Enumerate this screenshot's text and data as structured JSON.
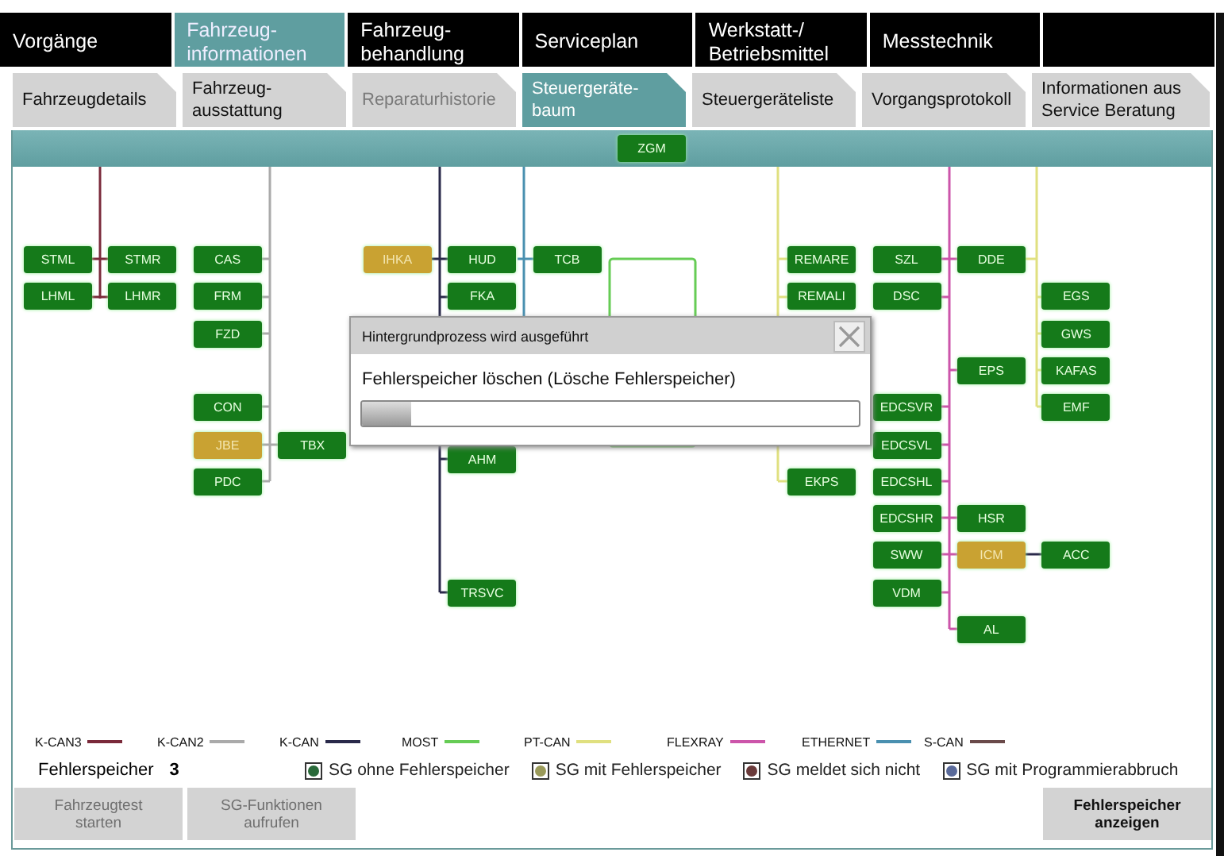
{
  "main_tabs": [
    {
      "label": "Vorgänge",
      "selected": false
    },
    {
      "label": "Fahrzeug-\ninformationen",
      "selected": true
    },
    {
      "label": "Fahrzeug-\nbehandlung",
      "selected": false
    },
    {
      "label": "Serviceplan",
      "selected": false
    },
    {
      "label": "Werkstatt-/\nBetriebsmittel",
      "selected": false
    },
    {
      "label": "Messtechnik",
      "selected": false
    }
  ],
  "sub_tabs": [
    {
      "label": "Fahrzeugdetails",
      "selected": false,
      "disabled": false
    },
    {
      "label": "Fahrzeug-\nausstattung",
      "selected": false,
      "disabled": false
    },
    {
      "label": "Reparaturhistorie",
      "selected": false,
      "disabled": true
    },
    {
      "label": "Steuergeräte-\nbaum",
      "selected": true,
      "disabled": false
    },
    {
      "label": "Steuergeräteliste",
      "selected": false,
      "disabled": false
    },
    {
      "label": "Vorgangsprotokoll",
      "selected": false,
      "disabled": false
    },
    {
      "label": "Informationen aus\nService Beratung",
      "selected": false,
      "disabled": false
    }
  ],
  "diagram": {
    "gateway": {
      "label": "ZGM",
      "fault": false
    },
    "nodes": [
      {
        "label": "STML",
        "fault": false
      },
      {
        "label": "STMR",
        "fault": false
      },
      {
        "label": "CAS",
        "fault": false
      },
      {
        "label": "IHKA",
        "fault": true
      },
      {
        "label": "HUD",
        "fault": false
      },
      {
        "label": "TCB",
        "fault": false
      },
      {
        "label": "REMARE",
        "fault": false
      },
      {
        "label": "SZL",
        "fault": false
      },
      {
        "label": "DDE",
        "fault": false
      },
      {
        "label": "LHML",
        "fault": false
      },
      {
        "label": "LHMR",
        "fault": false
      },
      {
        "label": "FRM",
        "fault": false
      },
      {
        "label": "FKA",
        "fault": false
      },
      {
        "label": "REMALI",
        "fault": false
      },
      {
        "label": "DSC",
        "fault": false
      },
      {
        "label": "EGS",
        "fault": false
      },
      {
        "label": "FZD",
        "fault": false
      },
      {
        "label": "GWS",
        "fault": false
      },
      {
        "label": "EPS",
        "fault": false
      },
      {
        "label": "KAFAS",
        "fault": false
      },
      {
        "label": "CON",
        "fault": false
      },
      {
        "label": "EDCSVR",
        "fault": false
      },
      {
        "label": "EMF",
        "fault": false
      },
      {
        "label": "JBE",
        "fault": true
      },
      {
        "label": "TBX",
        "fault": false
      },
      {
        "label": "AHM",
        "fault": false
      },
      {
        "label": "EDCSVL",
        "fault": false
      },
      {
        "label": "PDC",
        "fault": false
      },
      {
        "label": "EKPS",
        "fault": false
      },
      {
        "label": "EDCSHL",
        "fault": false
      },
      {
        "label": "EDCSHR",
        "fault": false
      },
      {
        "label": "HSR",
        "fault": false
      },
      {
        "label": "SWW",
        "fault": false
      },
      {
        "label": "ICM",
        "fault": true
      },
      {
        "label": "ACC",
        "fault": false
      },
      {
        "label": "TRSVC",
        "fault": false
      },
      {
        "label": "VDM",
        "fault": false
      },
      {
        "label": "AL",
        "fault": false
      }
    ]
  },
  "dialog": {
    "title": "Hintergrundprozess wird ausgeführt",
    "message": "Fehlerspeicher löschen (Lösche Fehlerspeicher)",
    "level": 0.1
  },
  "bus_legend": [
    {
      "label": "K-CAN3",
      "color": "#7a2a3a"
    },
    {
      "label": "K-CAN2",
      "color": "#aaaaaa"
    },
    {
      "label": "K-CAN",
      "color": "#2a2a4a"
    },
    {
      "label": "MOST",
      "color": "#66cc55"
    },
    {
      "label": "PT-CAN",
      "color": "#e0e080"
    },
    {
      "label": "FLEXRAY",
      "color": "#cc55aa"
    },
    {
      "label": "ETHERNET",
      "color": "#4a90b0"
    },
    {
      "label": "S-CAN",
      "color": "#6a4a4a"
    }
  ],
  "fault_memory": {
    "label": "Fehlerspeicher",
    "count": "3"
  },
  "status_legend": [
    {
      "label": "SG ohne Fehlerspeicher",
      "color": "#2a6a3a"
    },
    {
      "label": "SG mit Fehlerspeicher",
      "color": "#9a9a5a"
    },
    {
      "label": "SG meldet sich nicht",
      "color": "#6a3a3a"
    },
    {
      "label": "SG mit Programmierabbruch",
      "color": "#5a6a9a"
    }
  ],
  "buttons": [
    {
      "label": "Fahrzeugtest\nstarten",
      "disabled": true
    },
    {
      "label": "SG-Funktionen\naufrufen",
      "disabled": true
    },
    {
      "label": "Fehlerspeicher\nanzeigen",
      "disabled": false
    }
  ]
}
